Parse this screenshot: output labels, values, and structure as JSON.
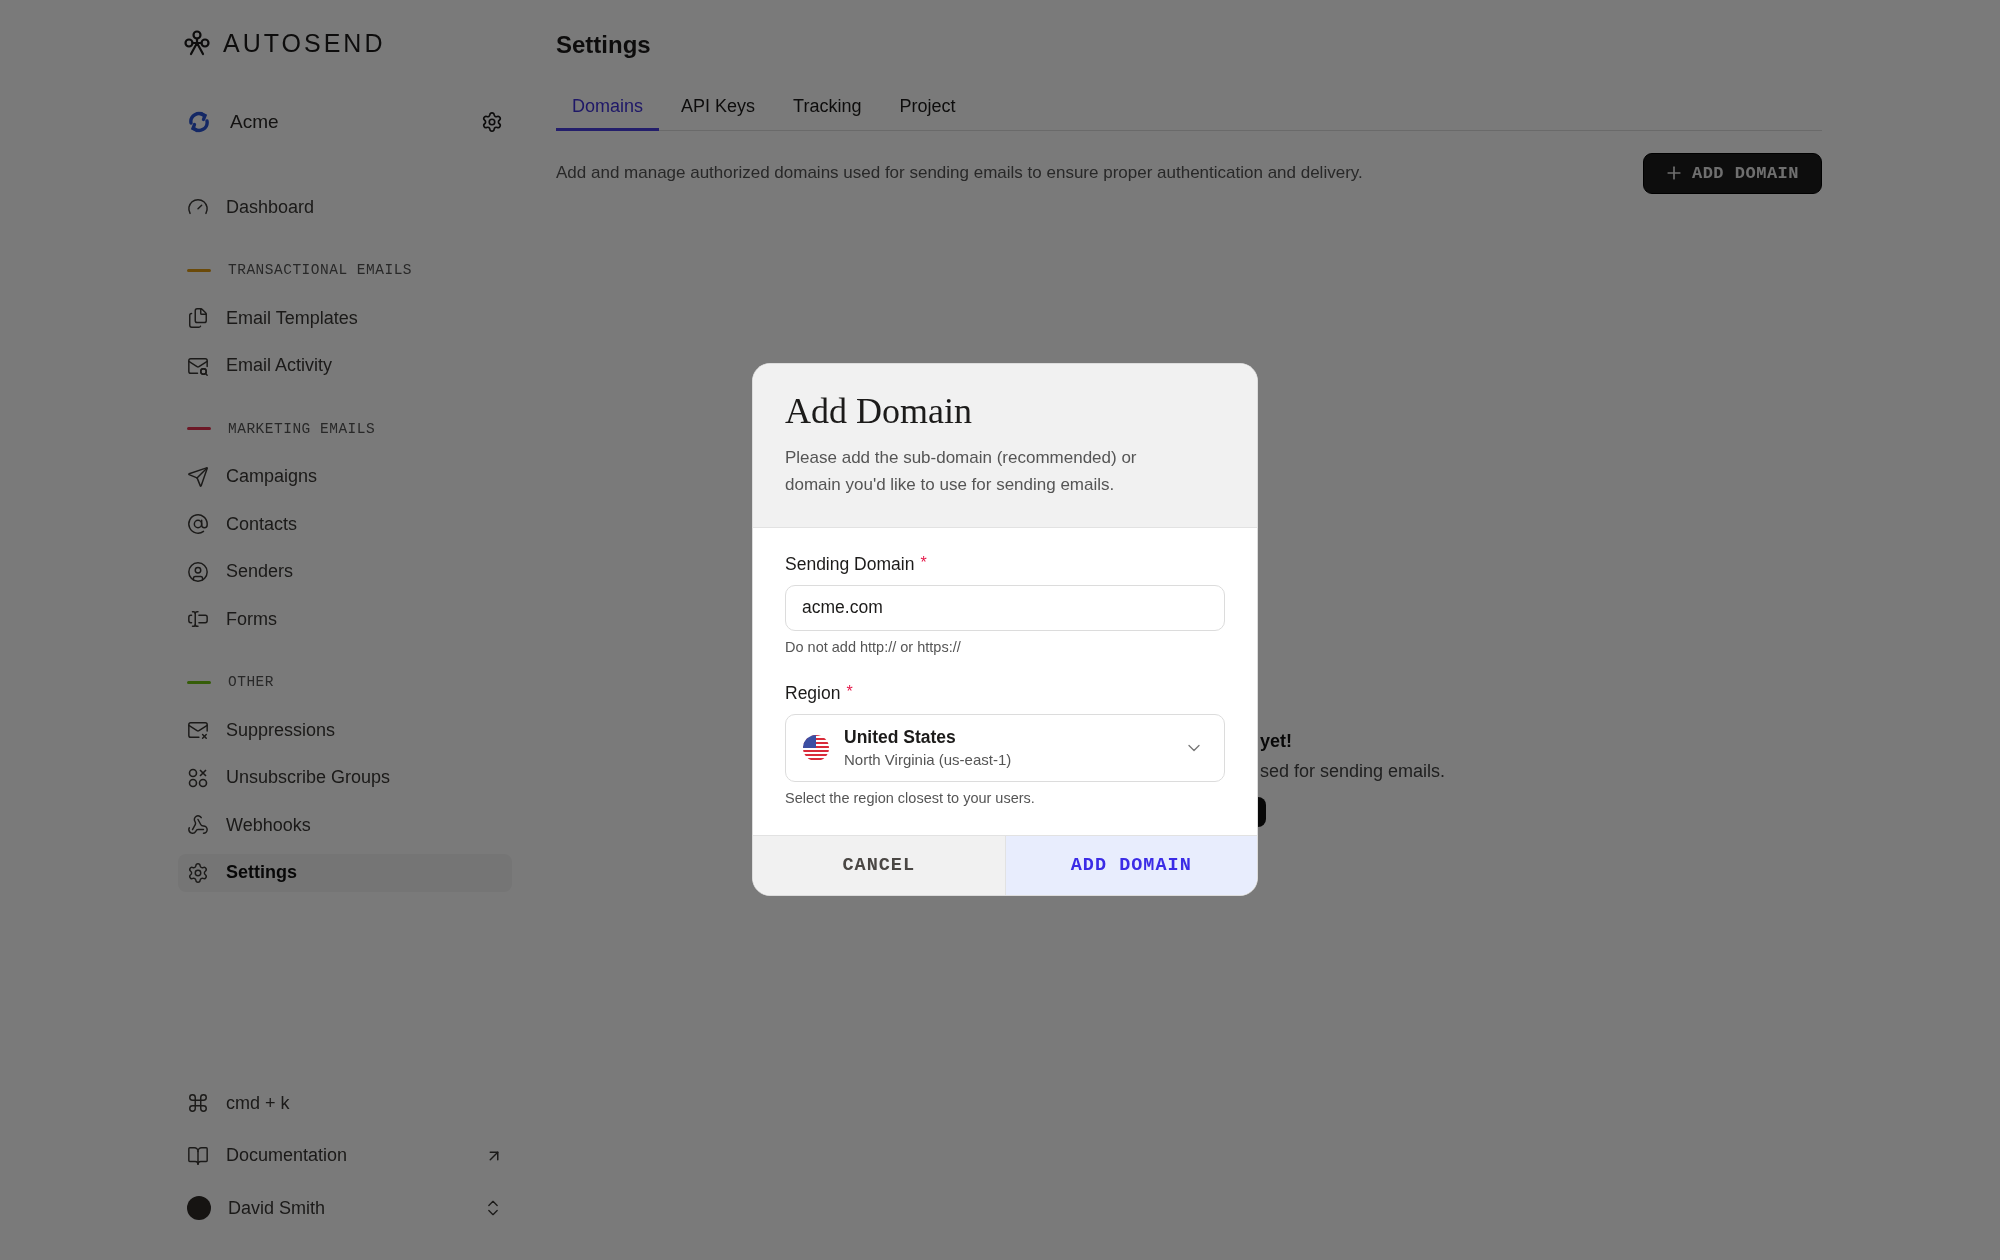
{
  "brand": {
    "name": "AUTOSEND"
  },
  "workspace": {
    "name": "Acme"
  },
  "nav": [
    {
      "kind": "plain",
      "items": [
        {
          "label": "Dashboard",
          "selected": false
        }
      ]
    },
    {
      "kind": "group",
      "title": "TRANSACTIONAL EMAILS",
      "color": "#6b4a09",
      "items": [
        {
          "label": "Email Templates",
          "selected": false
        },
        {
          "label": "Email Activity",
          "selected": false
        }
      ]
    },
    {
      "kind": "group",
      "title": "MARKETING EMAILS",
      "color": "#6d1826",
      "items": [
        {
          "label": "Campaigns",
          "selected": false
        },
        {
          "label": "Contacts",
          "selected": false
        },
        {
          "label": "Senders",
          "selected": false
        },
        {
          "label": "Forms",
          "selected": false
        }
      ]
    },
    {
      "kind": "group",
      "title": "OTHER",
      "color": "#355d08",
      "items": [
        {
          "label": "Suppressions",
          "selected": false
        },
        {
          "label": "Unsubscribe Groups",
          "selected": false
        },
        {
          "label": "Webhooks",
          "selected": false
        },
        {
          "label": "Settings",
          "selected": true
        }
      ]
    }
  ],
  "footer": [
    {
      "kind": "shortcut",
      "label": "cmd + k"
    },
    {
      "kind": "link",
      "label": "Documentation"
    },
    {
      "kind": "user",
      "label": "David Smith"
    }
  ],
  "page": {
    "title": "Settings",
    "description": "Add and manage authorized domains used for sending emails to ensure proper authentication and delivery.",
    "action": "ADD DOMAIN"
  },
  "tabs": [
    {
      "label": "Domains",
      "selected": true
    },
    {
      "label": "API Keys",
      "selected": false
    },
    {
      "label": "Tracking",
      "selected": false
    },
    {
      "label": "Project",
      "selected": false
    }
  ],
  "empty_state": {
    "title": "yet!",
    "text": "sed for sending emails."
  },
  "dialog": {
    "title": "Add Domain",
    "description": "Please add the sub-domain (recommended) or domain you'd like to use for sending emails.",
    "domain_field": {
      "label": "Sending Domain",
      "required_mark": "*",
      "value": "acme.com",
      "hint": "Do not add http:// or https://"
    },
    "region_field": {
      "label": "Region",
      "required_mark": "*",
      "value": "United States",
      "detail": "North Virginia (us-east-1)",
      "hint": "Select the region closest to your users."
    },
    "buttons": [
      {
        "label": "CANCEL",
        "kind": "secondary"
      },
      {
        "label": "ADD DOMAIN",
        "kind": "primary"
      }
    ]
  }
}
